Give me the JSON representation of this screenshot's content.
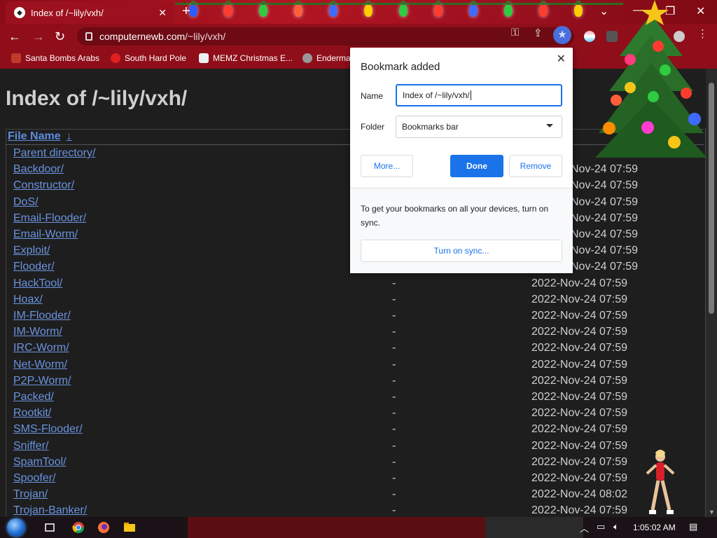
{
  "browser": {
    "tab_title": "Index of /~lily/vxh/",
    "new_tab_symbol": "+",
    "url_host": "computernewb.com",
    "url_path": "/~lily/vxh/"
  },
  "bookmarks_bar": [
    {
      "label": "Santa Bombs Arabs",
      "icon": "boot-icon",
      "color": "#c0392b"
    },
    {
      "label": "South Hard Pole",
      "icon": "flag-icon",
      "color": "#e02020"
    },
    {
      "label": "MEMZ Christmas E...",
      "icon": "page-icon",
      "color": "#eeeeee"
    },
    {
      "label": "Enderma",
      "icon": "raccoon-icon",
      "color": "#999999"
    }
  ],
  "page": {
    "heading": "Index of /~lily/vxh/",
    "column_header": "File Name",
    "sort_arrow": "↓",
    "rows": [
      {
        "name": "Parent directory/",
        "size": "",
        "date": ""
      },
      {
        "name": "Backdoor/",
        "size": "",
        "date": "Nov-24 07:59"
      },
      {
        "name": "Constructor/",
        "size": "",
        "date": "Nov-24 07:59"
      },
      {
        "name": "DoS/",
        "size": "",
        "date": "Nov-24 07:59"
      },
      {
        "name": "Email-Flooder/",
        "size": "",
        "date": "Nov-24 07:59"
      },
      {
        "name": "Email-Worm/",
        "size": "",
        "date": "Nov-24 07:59"
      },
      {
        "name": "Exploit/",
        "size": "",
        "date": "Nov-24 07:59"
      },
      {
        "name": "Flooder/",
        "size": "",
        "date": "Nov-24 07:59"
      },
      {
        "name": "HackTool/",
        "size": "-",
        "date": "2022-Nov-24 07:59"
      },
      {
        "name": "Hoax/",
        "size": "-",
        "date": "2022-Nov-24 07:59"
      },
      {
        "name": "IM-Flooder/",
        "size": "-",
        "date": "2022-Nov-24 07:59"
      },
      {
        "name": "IM-Worm/",
        "size": "-",
        "date": "2022-Nov-24 07:59"
      },
      {
        "name": "IRC-Worm/",
        "size": "-",
        "date": "2022-Nov-24 07:59"
      },
      {
        "name": "Net-Worm/",
        "size": "-",
        "date": "2022-Nov-24 07:59"
      },
      {
        "name": "P2P-Worm/",
        "size": "-",
        "date": "2022-Nov-24 07:59"
      },
      {
        "name": "Packed/",
        "size": "-",
        "date": "2022-Nov-24 07:59"
      },
      {
        "name": "Rootkit/",
        "size": "-",
        "date": "2022-Nov-24 07:59"
      },
      {
        "name": "SMS-Flooder/",
        "size": "-",
        "date": "2022-Nov-24 07:59"
      },
      {
        "name": "Sniffer/",
        "size": "-",
        "date": "2022-Nov-24 07:59"
      },
      {
        "name": "SpamTool/",
        "size": "-",
        "date": "2022-Nov-24 07:59"
      },
      {
        "name": "Spoofer/",
        "size": "-",
        "date": "2022-Nov-24 07:59"
      },
      {
        "name": "Trojan/",
        "size": "-",
        "date": "2022-Nov-24 08:02"
      },
      {
        "name": "Trojan-Banker/",
        "size": "-",
        "date": "2022-Nov-24 07:59"
      }
    ]
  },
  "dialog": {
    "title": "Bookmark added",
    "close_symbol": "✕",
    "name_label": "Name",
    "name_value": "Index of /~lily/vxh/",
    "folder_label": "Folder",
    "folder_value": "Bookmarks bar",
    "more_label": "More...",
    "done_label": "Done",
    "remove_label": "Remove",
    "sync_text": "To get your bookmarks on all your devices, turn on sync.",
    "sync_button": "Turn on sync..."
  },
  "taskbar": {
    "clock": "1:05:02 AM"
  },
  "colors": {
    "link": "#6a93df",
    "accent": "#1a73e8",
    "theme_red": "#8f0e1a"
  }
}
